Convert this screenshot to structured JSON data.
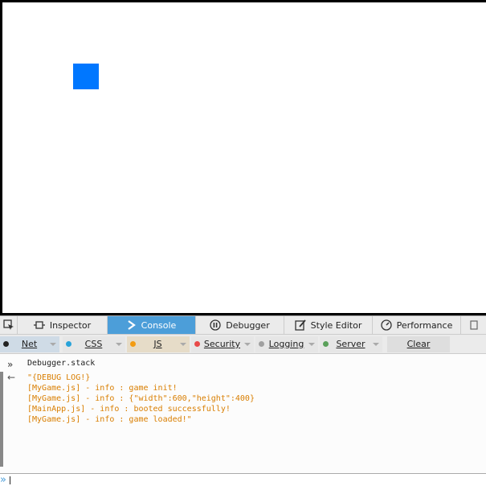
{
  "colors": {
    "sprite": "#0077ff",
    "tab_selected": "#4c9ed9",
    "net_dot": "#222222",
    "css_dot": "#29a3d9",
    "js_dot": "#f39c12",
    "security_dot": "#e84a4a",
    "logging_dot": "#a0a0a0",
    "server_dot": "#5aa05a",
    "log_text": "#d97e00"
  },
  "tabs": [
    {
      "label": "Inspector",
      "icon": "inspector-icon"
    },
    {
      "label": "Console",
      "icon": "console-icon"
    },
    {
      "label": "Debugger",
      "icon": "debugger-icon"
    },
    {
      "label": "Style Editor",
      "icon": "style-editor-icon"
    },
    {
      "label": "Performance",
      "icon": "performance-icon"
    }
  ],
  "filters": {
    "net": "Net",
    "css": "CSS",
    "js": "JS",
    "security": "Security",
    "logging": "Logging",
    "server": "Server",
    "clear": "Clear"
  },
  "console": {
    "input_marker": "»",
    "input": "Debugger.stack",
    "result_arrow": "←",
    "output_lines": "\"{DEBUG LOG!}\n[MyGame.js] - info : game init!\n[MyGame.js] - info : {\"width\":600,\"height\":400}\n[MainApp.js] - info : booted successfully!\n[MyGame.js] - info : game loaded!\""
  },
  "cmdline": {
    "prompt": "»"
  }
}
